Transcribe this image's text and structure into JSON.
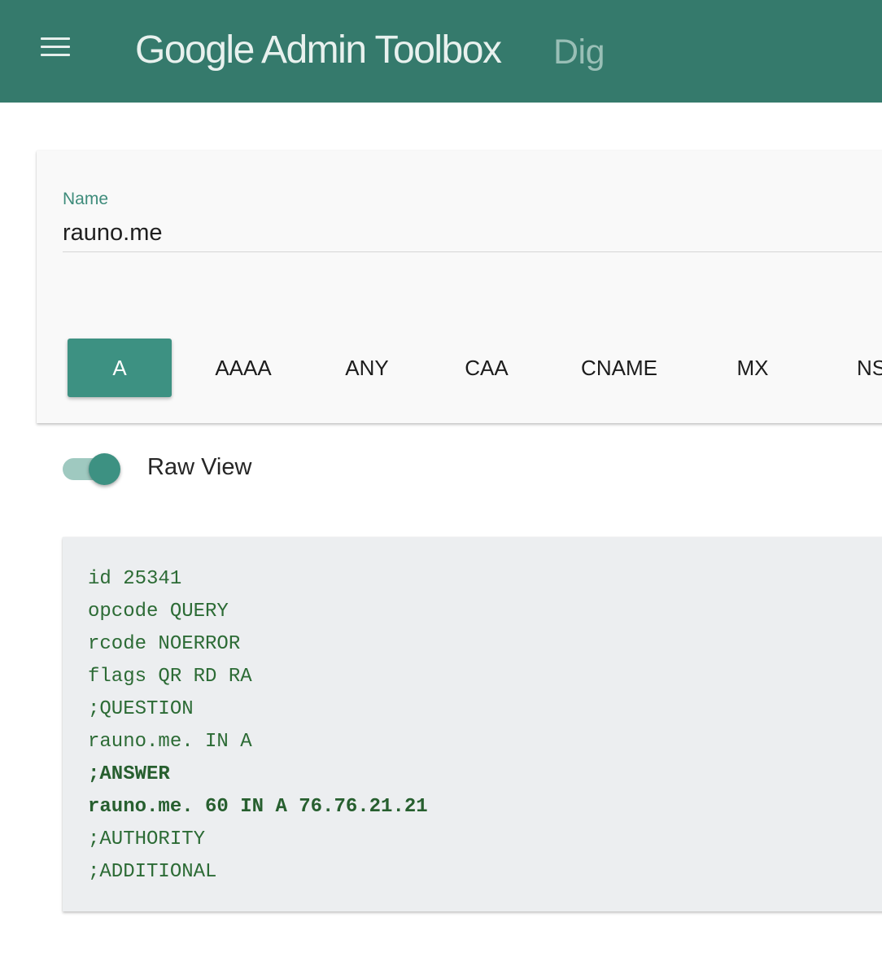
{
  "header": {
    "menu_icon": "hamburger-menu-icon",
    "title": "Google Admin Toolbox",
    "subtitle": "Dig"
  },
  "query": {
    "name_label": "Name",
    "name_value": "rauno.me",
    "record_types": [
      {
        "label": "A",
        "active": true
      },
      {
        "label": "AAAA",
        "active": false
      },
      {
        "label": "ANY",
        "active": false
      },
      {
        "label": "CAA",
        "active": false
      },
      {
        "label": "CNAME",
        "active": false
      },
      {
        "label": "MX",
        "active": false
      },
      {
        "label": "NS",
        "active": false
      }
    ]
  },
  "raw_view": {
    "label": "Raw View",
    "enabled": true
  },
  "response": {
    "lines": [
      {
        "text": "id 25341",
        "bold": false
      },
      {
        "text": "opcode QUERY",
        "bold": false
      },
      {
        "text": "rcode NOERROR",
        "bold": false
      },
      {
        "text": "flags QR RD RA",
        "bold": false
      },
      {
        "text": ";QUESTION",
        "bold": false
      },
      {
        "text": "rauno.me. IN A",
        "bold": false
      },
      {
        "text": ";ANSWER",
        "bold": true
      },
      {
        "text": "rauno.me. 60 IN A 76.76.21.21",
        "bold": true
      },
      {
        "text": ";AUTHORITY",
        "bold": false
      },
      {
        "text": ";ADDITIONAL",
        "bold": false
      }
    ]
  },
  "colors": {
    "primary": "#357a6c",
    "accent": "#3d9182",
    "response_text": "#2c6b35"
  }
}
